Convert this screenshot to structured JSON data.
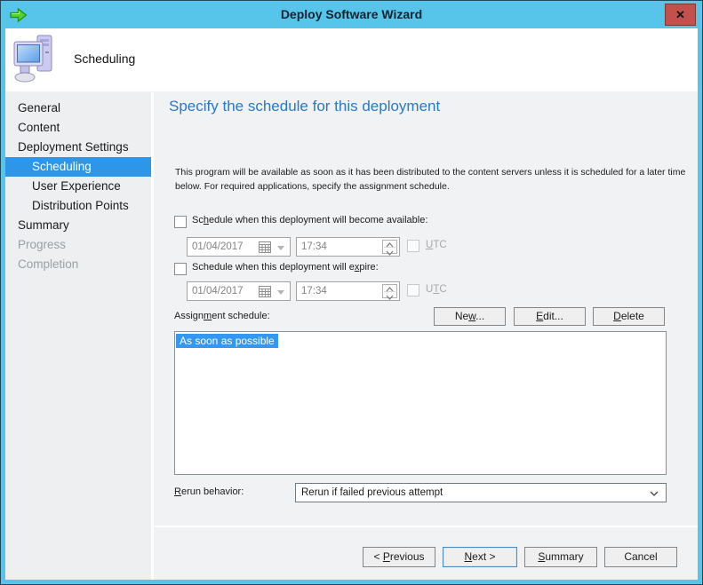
{
  "colors": {
    "titlebar_blue": "#56c5e9",
    "close_red": "#c4504e",
    "selection_blue": "#2d96e9",
    "heading_blue": "#2a79c7",
    "list_selection_blue": "#3498f3"
  },
  "titlebar": {
    "title": "Deploy Software Wizard",
    "close_glyph": "✕"
  },
  "header": {
    "step_title": "Scheduling"
  },
  "sidebar": {
    "items": [
      {
        "label": "General",
        "indent": 1,
        "state": "normal"
      },
      {
        "label": "Content",
        "indent": 1,
        "state": "normal"
      },
      {
        "label": "Deployment Settings",
        "indent": 1,
        "state": "normal"
      },
      {
        "label": "Scheduling",
        "indent": 2,
        "state": "selected"
      },
      {
        "label": "User Experience",
        "indent": 2,
        "state": "normal"
      },
      {
        "label": "Distribution Points",
        "indent": 2,
        "state": "normal"
      },
      {
        "label": "Summary",
        "indent": 1,
        "state": "normal"
      },
      {
        "label": "Progress",
        "indent": 1,
        "state": "disabled"
      },
      {
        "label": "Completion",
        "indent": 1,
        "state": "disabled"
      }
    ]
  },
  "main": {
    "heading": "Specify the schedule for this deployment",
    "description": "This program will be available as soon as it has been distributed to the content servers unless it is scheduled for a later time below. For required applications, specify the assignment schedule.",
    "available_checkbox": {
      "pre": "Sc",
      "key": "h",
      "post": "edule when this deployment will become available:",
      "checked": false
    },
    "expire_checkbox": {
      "pre": "Schedule when this deployment will e",
      "key": "x",
      "post": "pire:",
      "checked": false
    },
    "available_date": "01/04/2017",
    "available_time": "17:34",
    "expire_date": "01/04/2017",
    "expire_time": "17:34",
    "utc1": {
      "pre": "",
      "key": "U",
      "post": "TC",
      "checked": false
    },
    "utc2": {
      "pre": "U",
      "key": "T",
      "post": "C",
      "checked": false
    },
    "assignment_label": {
      "pre": "Assign",
      "key": "m",
      "post": "ent schedule:"
    },
    "new_button": {
      "pre": "Ne",
      "key": "w",
      "post": "..."
    },
    "edit_button": {
      "pre": "",
      "key": "E",
      "post": "dit..."
    },
    "delete_button": {
      "pre": "",
      "key": "D",
      "post": "elete"
    },
    "schedule_list": [
      {
        "label": "As soon as possible",
        "selected": true
      }
    ],
    "rerun_label": {
      "pre": "",
      "key": "R",
      "post": "erun behavior:"
    },
    "rerun_value": "Rerun if failed previous attempt"
  },
  "footer": {
    "previous_button": {
      "pre": "< ",
      "key": "P",
      "post": "revious"
    },
    "next_button": {
      "pre": "",
      "key": "N",
      "post": "ext >"
    },
    "summary_button": {
      "pre": "",
      "key": "S",
      "post": "ummary"
    },
    "cancel_button": {
      "label": "Cancel"
    }
  }
}
